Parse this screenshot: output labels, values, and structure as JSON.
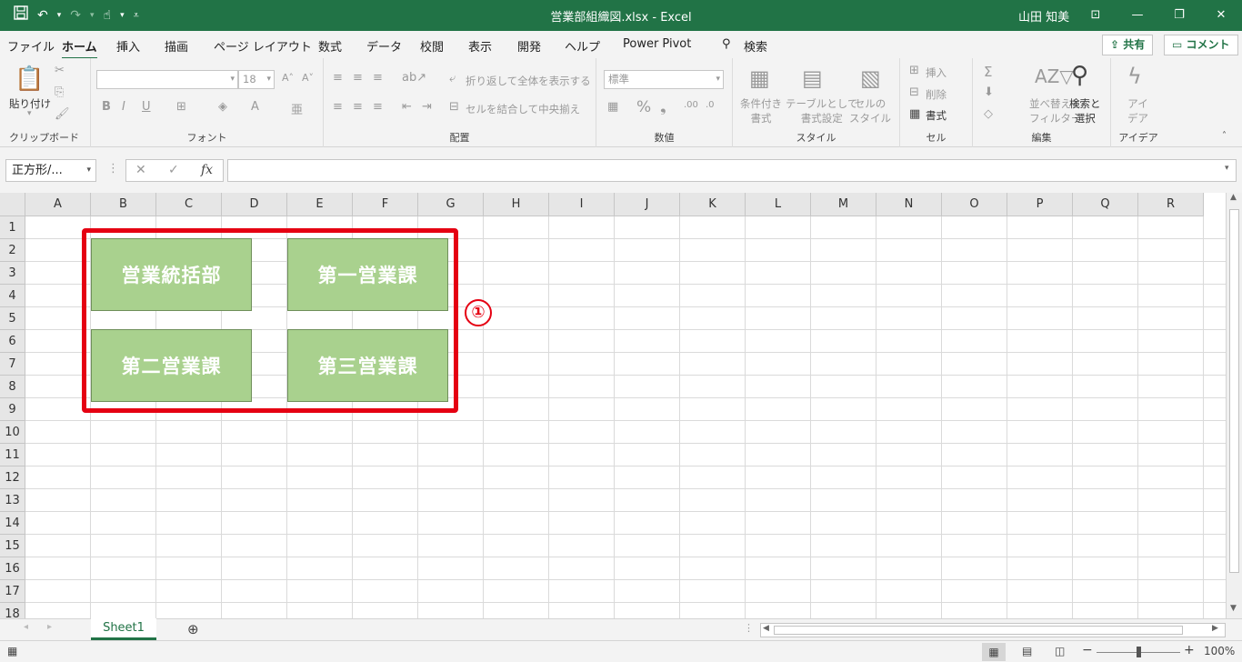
{
  "title_bar": {
    "title": "営業部組織図.xlsx  -  Excel",
    "user": "山田 知美",
    "qat": {
      "save_icon": "save-icon",
      "undo": "↶",
      "redo": "↷",
      "touch": "☝",
      "customize": "⋮"
    },
    "window": {
      "ribbon_options": "⊡",
      "minimize": "—",
      "restore": "❐",
      "close": "✕"
    }
  },
  "tabs": [
    {
      "label": "ファイル"
    },
    {
      "label": "ホーム"
    },
    {
      "label": "挿入"
    },
    {
      "label": "描画"
    },
    {
      "label": "ページ レイアウト"
    },
    {
      "label": "数式"
    },
    {
      "label": "データ"
    },
    {
      "label": "校閲"
    },
    {
      "label": "表示"
    },
    {
      "label": "開発"
    },
    {
      "label": "ヘルプ"
    },
    {
      "label": "Power Pivot"
    }
  ],
  "active_tab": "ホーム",
  "search": {
    "label": "検索"
  },
  "share": {
    "label": "共有"
  },
  "comment": {
    "label": "コメント"
  },
  "ribbon": {
    "clipboard": {
      "paste": "貼り付け",
      "label": "クリップボード"
    },
    "font": {
      "font_name": "",
      "font_size": "18",
      "label": "フォント"
    },
    "alignment": {
      "wrap": "折り返して全体を表示する",
      "merge": "セルを結合して中央揃え",
      "label": "配置"
    },
    "number": {
      "format": "標準",
      "label": "数値"
    },
    "styles": {
      "conditional": "条件付き\n書式",
      "table": "テーブルとして\n書式設定",
      "cell": "セルの\nスタイル",
      "label": "スタイル"
    },
    "cells": {
      "insert": "挿入",
      "delete": "削除",
      "format": "書式",
      "label": "セル"
    },
    "editing": {
      "sort": "並べ替えと\nフィルター",
      "find": "検索と\n選択",
      "label": "編集"
    },
    "ideas": {
      "ideas": "アイ\nデア",
      "label": "アイデア"
    }
  },
  "formula_bar": {
    "name_box": "正方形/...",
    "cancel": "✕",
    "enter": "✓",
    "fx": "fx",
    "value": ""
  },
  "columns": [
    "A",
    "B",
    "C",
    "D",
    "E",
    "F",
    "G",
    "H",
    "I",
    "J",
    "K",
    "L",
    "M",
    "N",
    "O",
    "P",
    "Q",
    "R"
  ],
  "rows": [
    "1",
    "2",
    "3",
    "4",
    "5",
    "6",
    "7",
    "8",
    "9",
    "10",
    "11",
    "12",
    "13",
    "14",
    "15",
    "16",
    "17",
    "18"
  ],
  "shapes": [
    {
      "text": "営業統括部"
    },
    {
      "text": "第一営業課"
    },
    {
      "text": "第二営業課"
    },
    {
      "text": "第三営業課"
    }
  ],
  "annotation": {
    "marker": "①",
    "color": "#e50012"
  },
  "colors": {
    "excel_green": "#217346",
    "shape_fill": "#a9d18e"
  },
  "sheet_tabs": [
    {
      "label": "Sheet1"
    }
  ],
  "status": {
    "zoom": "100%"
  }
}
